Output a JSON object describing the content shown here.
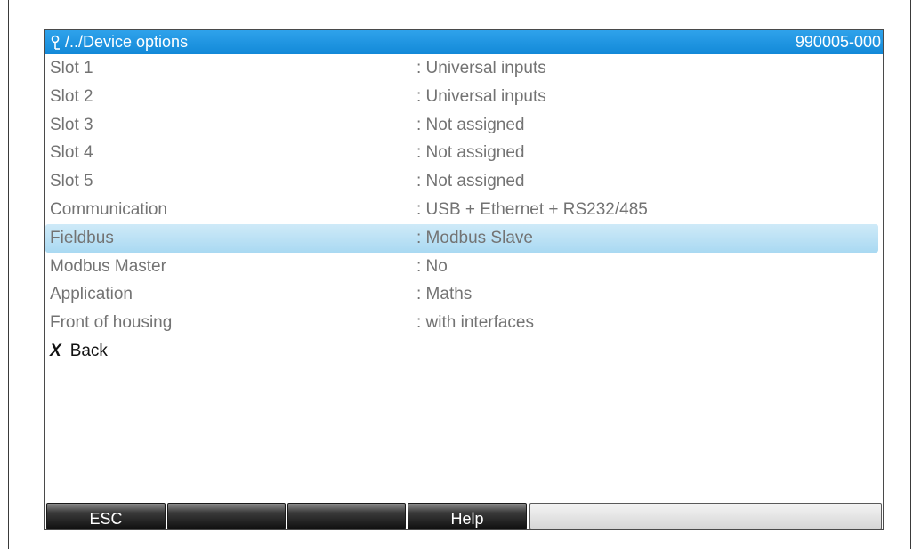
{
  "header": {
    "path": "/../Device options",
    "code": "990005-000"
  },
  "rows": [
    {
      "label": "Slot 1",
      "value": ": Universal inputs"
    },
    {
      "label": "Slot 2",
      "value": ": Universal inputs"
    },
    {
      "label": "Slot 3",
      "value": ": Not assigned"
    },
    {
      "label": "Slot 4",
      "value": ": Not assigned"
    },
    {
      "label": "Slot 5",
      "value": ": Not assigned"
    },
    {
      "label": "Communication",
      "value": ": USB + Ethernet + RS232/485"
    },
    {
      "label": "Fieldbus",
      "value": ": Modbus Slave"
    },
    {
      "label": "Modbus Master",
      "value": ": No"
    },
    {
      "label": "Application",
      "value": ": Maths"
    },
    {
      "label": "Front of housing",
      "value": ": with interfaces"
    }
  ],
  "selected_row": "Fieldbus",
  "back": {
    "label": "Back"
  },
  "softkeys": {
    "esc": "ESC",
    "key2": "",
    "key3": "",
    "help": "Help"
  },
  "colors": {
    "title_bar": "#1289d8",
    "selection": "#a9d9f2",
    "text": "#737373"
  },
  "icons": {
    "title": "wrench-icon",
    "back": "x-back-icon"
  }
}
